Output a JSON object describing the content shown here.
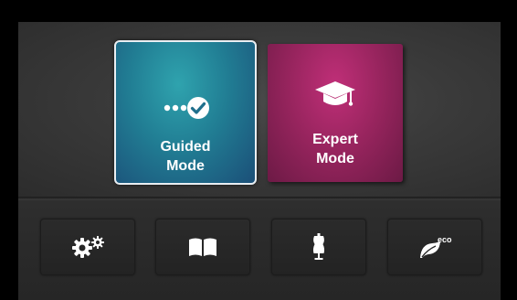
{
  "modes": {
    "guided": {
      "line1": "Guided",
      "line2": "Mode",
      "icon": "guided-steps-check-icon",
      "selected": true,
      "color": "#217e94"
    },
    "expert": {
      "line1": "Expert",
      "line2": "Mode",
      "icon": "graduation-cap-icon",
      "selected": false,
      "color": "#96245d"
    }
  },
  "function_buttons": [
    {
      "name": "settings",
      "icon": "gears-icon"
    },
    {
      "name": "manual",
      "icon": "open-book-icon"
    },
    {
      "name": "sewing-mode",
      "icon": "dress-form-icon"
    },
    {
      "name": "eco-mode",
      "icon": "eco-leaf-icon",
      "badge": "eco"
    }
  ]
}
